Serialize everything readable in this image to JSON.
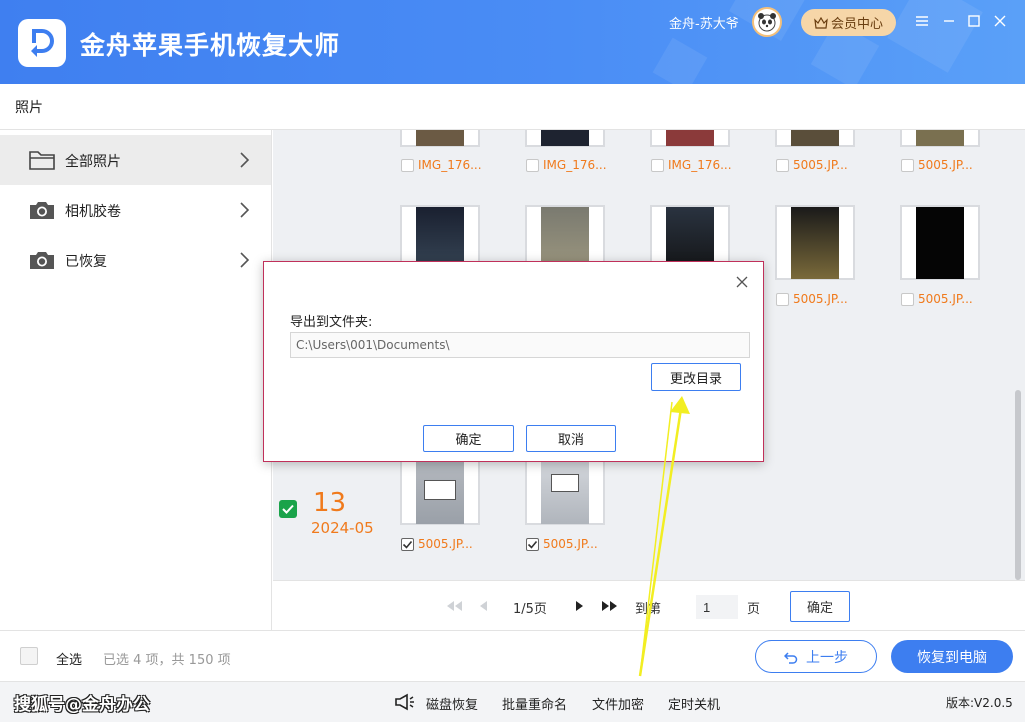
{
  "header": {
    "app_title": "金舟苹果手机恢复大师",
    "user_name": "金舟-苏大爷",
    "vip_label": "会员中心",
    "colors": {
      "header_bg": "#4a8df5",
      "accent": "#3d7ef0",
      "file_name": "#f07a1c",
      "check_green": "#1aa34a"
    }
  },
  "breadcrumb": {
    "title": "照片"
  },
  "sidebar": {
    "items": [
      {
        "label": "全部照片",
        "icon": "folder-icon",
        "active": true
      },
      {
        "label": "相机胶卷",
        "icon": "camera-icon",
        "active": false
      },
      {
        "label": "已恢复",
        "icon": "camera-icon",
        "active": false
      }
    ]
  },
  "gallery": {
    "top_row": [
      "IMG_176...",
      "IMG_176...",
      "IMG_176...",
      "5005.JP...",
      "5005.JP..."
    ],
    "second_row": [
      "5005.JP...",
      "5005.JP..."
    ],
    "group": {
      "day": "13",
      "year_month": "2024-05",
      "files": [
        "5005.JP...",
        "5005.JP..."
      ]
    }
  },
  "pagination": {
    "page_info": "1/5页",
    "goto_label": "到第",
    "page_value": "1",
    "page_unit": "页",
    "ok_label": "确定"
  },
  "actions": {
    "select_all": "全选",
    "selection_info": "已选 4 项，共 150 项",
    "prev_label": "上一步",
    "recover_label": "恢复到电脑"
  },
  "bottom_bar": {
    "watermark": "搜狐号@金舟办公",
    "tools": [
      "磁盘恢复",
      "批量重命名",
      "文件加密",
      "定时关机"
    ],
    "version": "版本:V2.0.5"
  },
  "dialog": {
    "label": "导出到文件夹:",
    "path": "C:\\Users\\001\\Documents\\",
    "change_dir": "更改目录",
    "ok": "确定",
    "cancel": "取消"
  }
}
